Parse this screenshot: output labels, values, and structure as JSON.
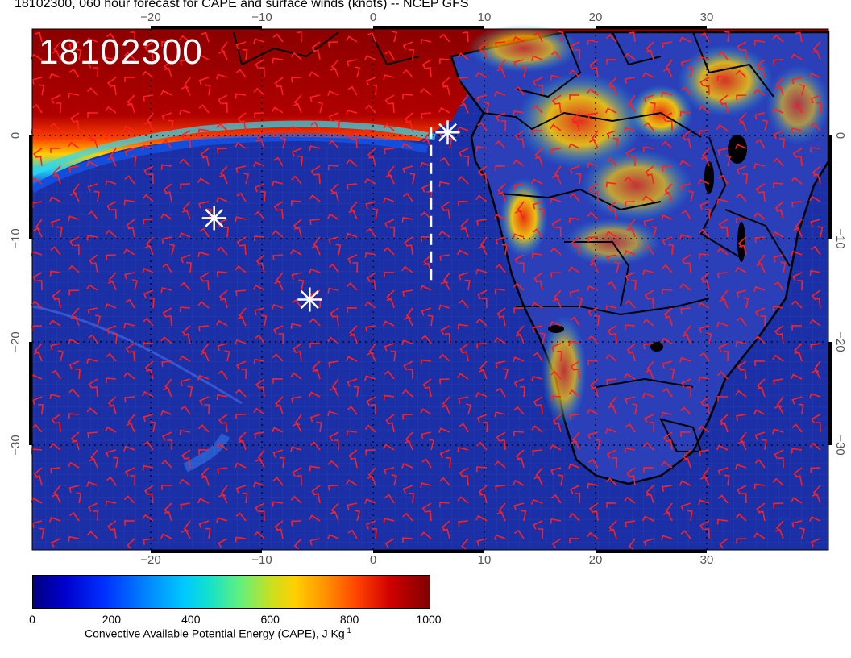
{
  "title": "18102300, 060 hour forecast for CAPE and surface winds (knots) -- NCEP GFS",
  "date_stamp": "18102300",
  "axes": {
    "lon_ticks": [
      "−20",
      "−10",
      "0",
      "10",
      "20",
      "30"
    ],
    "lat_ticks": [
      "0",
      "−10",
      "−20",
      "−30"
    ]
  },
  "colorbar": {
    "ticks": [
      "0",
      "200",
      "400",
      "600",
      "800",
      "1000"
    ],
    "label": "Convective Available Potential Energy (CAPE), J Kg",
    "label_sup": "-1",
    "range": [
      0,
      1000
    ]
  },
  "markers": [
    {
      "name": "star-marker-1",
      "lon": 6.7,
      "lat": 0.3
    },
    {
      "name": "star-marker-2",
      "lon": -14.3,
      "lat": -8.0
    },
    {
      "name": "star-marker-3",
      "lon": -5.7,
      "lat": -15.9
    }
  ],
  "transect": {
    "lon": 5.2,
    "lat_start": 0.8,
    "lat_end": -14.0
  },
  "colors": {
    "wind_barbs": "#ff2020",
    "ocean": "#1a2fa8",
    "high_cape": "#8b0000",
    "markers": "#ffffff"
  }
}
